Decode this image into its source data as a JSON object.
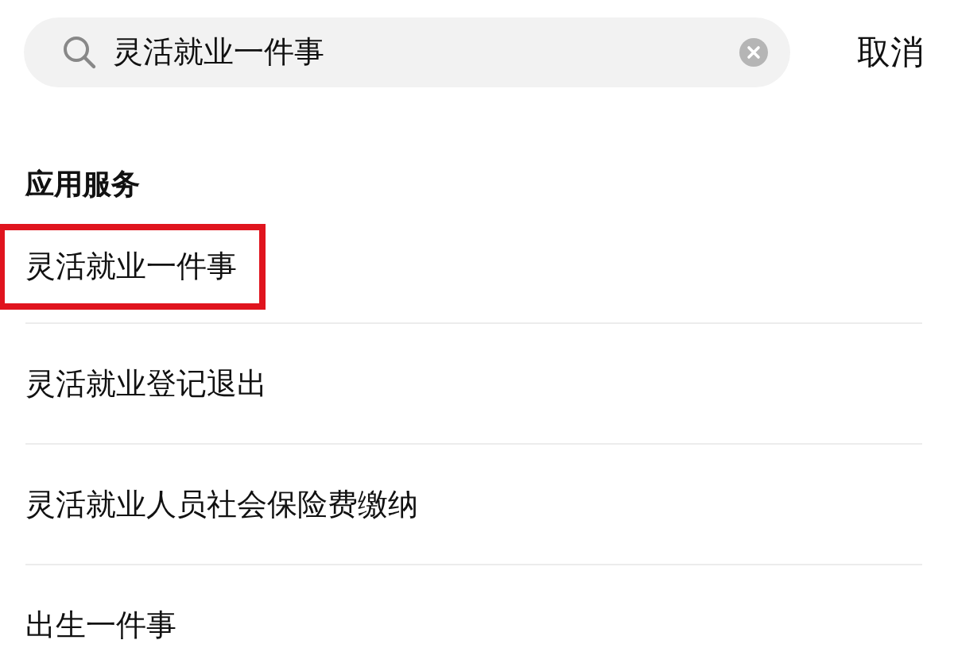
{
  "search": {
    "value": "灵活就业一件事",
    "cancel": "取消"
  },
  "section": {
    "title": "应用服务",
    "items": [
      {
        "label": "灵活就业一件事",
        "highlighted": true
      },
      {
        "label": "灵活就业登记退出",
        "highlighted": false
      },
      {
        "label": "灵活就业人员社会保险费缴纳",
        "highlighted": false
      },
      {
        "label": "出生一件事",
        "highlighted": false
      }
    ]
  }
}
